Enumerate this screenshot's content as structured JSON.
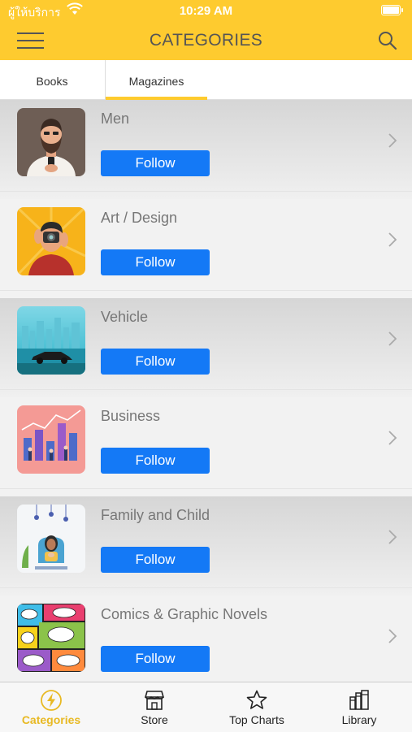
{
  "status": {
    "carrier": "ผู้ให้บริการ",
    "time": "10:29 AM"
  },
  "header": {
    "title": "CATEGORIES",
    "menu_icon": "hamburger-icon",
    "search_icon": "search-icon"
  },
  "tabs": [
    {
      "label": "Books",
      "selected": false
    },
    {
      "label": "Magazines",
      "selected": true
    }
  ],
  "categories": [
    {
      "title": "Men",
      "follow_label": "Follow",
      "thumbnail": "bearded-man-illustration"
    },
    {
      "title": "Art / Design",
      "follow_label": "Follow",
      "thumbnail": "photographer-illustration"
    },
    {
      "title": "Vehicle",
      "follow_label": "Follow",
      "thumbnail": "car-city-illustration"
    },
    {
      "title": "Business",
      "follow_label": "Follow",
      "thumbnail": "business-chart-illustration"
    },
    {
      "title": "Family and Child",
      "follow_label": "Follow",
      "thumbnail": "mother-child-illustration"
    },
    {
      "title": "Comics & Graphic Novels",
      "follow_label": "Follow",
      "thumbnail": "comic-bubbles-illustration"
    }
  ],
  "tabbar": [
    {
      "label": "Categories",
      "icon": "lightning-circle-icon",
      "active": true
    },
    {
      "label": "Store",
      "icon": "store-icon",
      "active": false
    },
    {
      "label": "Top Charts",
      "icon": "star-icon",
      "active": false
    },
    {
      "label": "Library",
      "icon": "library-icon",
      "active": false
    }
  ],
  "colors": {
    "accent": "#FECB2F",
    "follow_button": "#1479F6",
    "active_tab": "#E8B923"
  }
}
